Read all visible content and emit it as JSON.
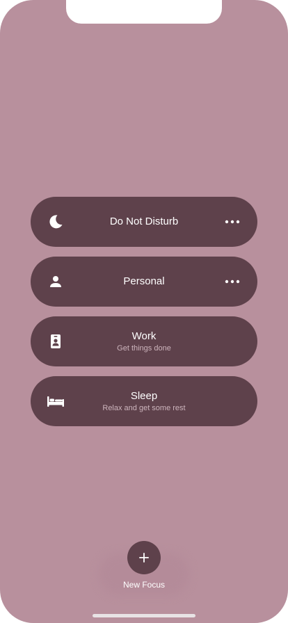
{
  "colors": {
    "background": "#b8909d",
    "row_fill": "#5e414b",
    "subtitle_text": "#cdb5bd"
  },
  "focus_modes": [
    {
      "icon": "moon-icon",
      "title": "Do Not Disturb",
      "subtitle": "",
      "has_more": true
    },
    {
      "icon": "person-icon",
      "title": "Personal",
      "subtitle": "",
      "has_more": true
    },
    {
      "icon": "id-badge-icon",
      "title": "Work",
      "subtitle": "Get things done",
      "has_more": false
    },
    {
      "icon": "bed-icon",
      "title": "Sleep",
      "subtitle": "Relax and get some rest",
      "has_more": false
    }
  ],
  "new_focus": {
    "icon": "plus-icon",
    "label": "New Focus"
  }
}
